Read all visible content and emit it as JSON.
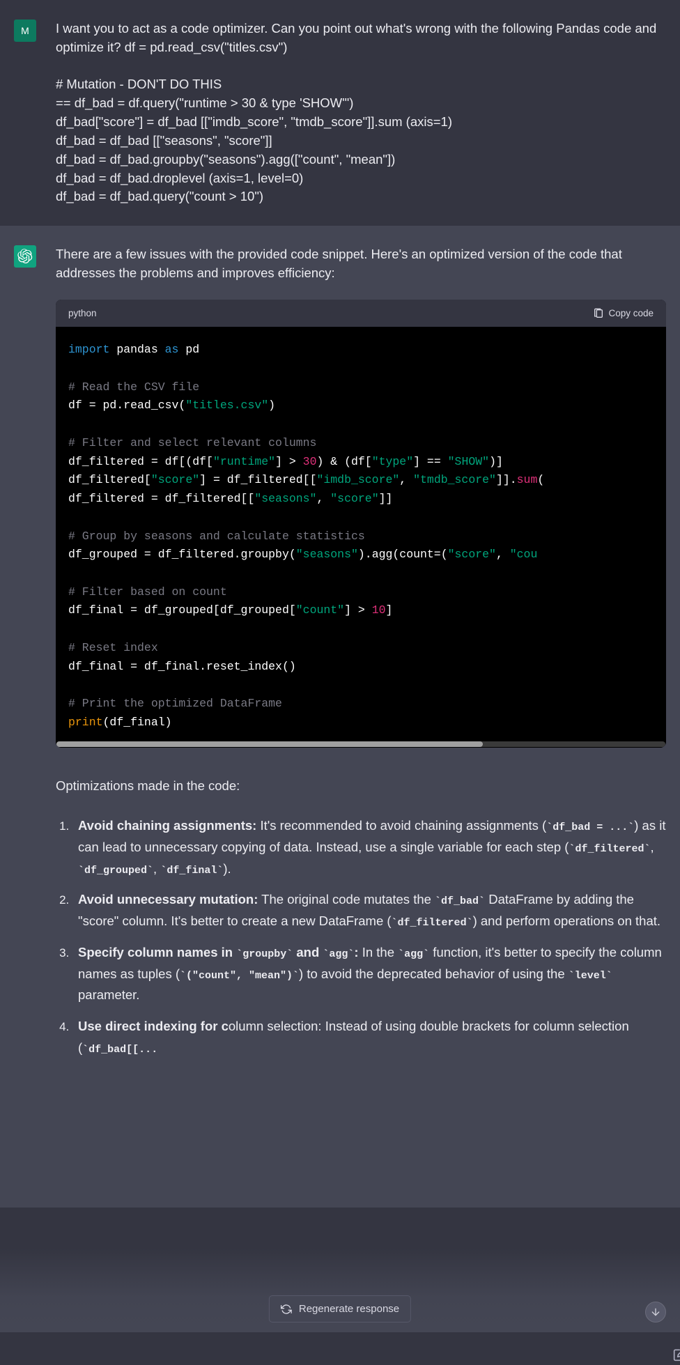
{
  "user": {
    "avatar_letter": "M",
    "message": "I want you to act as a code optimizer. Can you point out what's wrong with the following Pandas code and optimize it? df = pd.read_csv(\"titles.csv\")\n\n# Mutation - DON'T DO THIS\n== df_bad = df.query(\"runtime > 30 & type 'SHOW'\")\ndf_bad[\"score\"] = df_bad [[\"imdb_score\", \"tmdb_score\"]].sum (axis=1)\ndf_bad = df_bad [[\"seasons\", \"score\"]]\ndf_bad = df_bad.groupby(\"seasons\").agg([\"count\", \"mean\"])\ndf_bad = df_bad.droplevel (axis=1, level=0)\ndf_bad = df_bad.query(\"count > 10\")"
  },
  "assistant": {
    "intro": "There are a few issues with the provided code snippet. Here's an optimized version of the code that addresses the problems and improves efficiency:",
    "code_lang": "python",
    "copy_label": "Copy code",
    "code_tokens": [
      [
        [
          "kw",
          "import"
        ],
        [
          "p",
          " pandas "
        ],
        [
          "kw",
          "as"
        ],
        [
          "p",
          " pd"
        ]
      ],
      [],
      [
        [
          "com",
          "# Read the CSV file"
        ]
      ],
      [
        [
          "p",
          "df = pd.read_csv("
        ],
        [
          "str",
          "\"titles.csv\""
        ],
        [
          "p",
          ")"
        ]
      ],
      [],
      [
        [
          "com",
          "# Filter and select relevant columns"
        ]
      ],
      [
        [
          "p",
          "df_filtered = df[(df["
        ],
        [
          "str",
          "\"runtime\""
        ],
        [
          "p",
          "] > "
        ],
        [
          "num",
          "30"
        ],
        [
          "p",
          ") & (df["
        ],
        [
          "str",
          "\"type\""
        ],
        [
          "p",
          "] == "
        ],
        [
          "str",
          "\"SHOW\""
        ],
        [
          "p",
          ")]"
        ]
      ],
      [
        [
          "p",
          "df_filtered["
        ],
        [
          "str",
          "\"score\""
        ],
        [
          "p",
          "] = df_filtered[["
        ],
        [
          "str",
          "\"imdb_score\""
        ],
        [
          "p",
          ", "
        ],
        [
          "str",
          "\"tmdb_score\""
        ],
        [
          "p",
          "]]."
        ],
        [
          "fn",
          "sum"
        ],
        [
          "p",
          "("
        ]
      ],
      [
        [
          "p",
          "df_filtered = df_filtered[["
        ],
        [
          "str",
          "\"seasons\""
        ],
        [
          "p",
          ", "
        ],
        [
          "str",
          "\"score\""
        ],
        [
          "p",
          "]]"
        ]
      ],
      [],
      [
        [
          "com",
          "# Group by seasons and calculate statistics"
        ]
      ],
      [
        [
          "p",
          "df_grouped = df_filtered.groupby("
        ],
        [
          "str",
          "\"seasons\""
        ],
        [
          "p",
          ").agg(count=("
        ],
        [
          "str",
          "\"score\""
        ],
        [
          "p",
          ", "
        ],
        [
          "str",
          "\"cou"
        ]
      ],
      [],
      [
        [
          "com",
          "# Filter based on count"
        ]
      ],
      [
        [
          "p",
          "df_final = df_grouped[df_grouped["
        ],
        [
          "str",
          "\"count\""
        ],
        [
          "p",
          "] > "
        ],
        [
          "num",
          "10"
        ],
        [
          "p",
          "]"
        ]
      ],
      [],
      [
        [
          "com",
          "# Reset index"
        ]
      ],
      [
        [
          "p",
          "df_final = df_final.reset_index()"
        ]
      ],
      [],
      [
        [
          "com",
          "# Print the optimized DataFrame"
        ]
      ],
      [
        [
          "bi",
          "print"
        ],
        [
          "p",
          "(df_final)"
        ]
      ]
    ],
    "opt_heading": "Optimizations made in the code:",
    "items": [
      {
        "bold": "Avoid chaining assignments:",
        "segs": [
          {
            "t": " It's recommended to avoid chaining assignments ("
          },
          {
            "c": "`df_bad = ...`"
          },
          {
            "t": ") as it can lead to unnecessary copying of data. Instead, use a single variable for each step ("
          },
          {
            "c": "`df_filtered`"
          },
          {
            "t": ", "
          },
          {
            "c": "`df_grouped`"
          },
          {
            "t": ", "
          },
          {
            "c": "`df_final`"
          },
          {
            "t": ")."
          }
        ]
      },
      {
        "bold": "Avoid unnecessary mutation:",
        "segs": [
          {
            "t": " The original code mutates the "
          },
          {
            "c": "`df_bad`"
          },
          {
            "t": " DataFrame by adding the \"score\" column. It's better to create a new DataFrame ("
          },
          {
            "c": "`df_filtered`"
          },
          {
            "t": ") and perform operations on that."
          }
        ]
      },
      {
        "bold_segs": [
          {
            "t": "Specify column names in "
          },
          {
            "c": "`groupby`"
          },
          {
            "t": " and "
          },
          {
            "c": "`agg`"
          },
          {
            "t": ":"
          }
        ],
        "segs": [
          {
            "t": " In the "
          },
          {
            "c": "`agg`"
          },
          {
            "t": " function, it's better to specify the column names as tuples ("
          },
          {
            "c": "`(\"count\", \"mean\")`"
          },
          {
            "t": ") to avoid the deprecated behavior of using the "
          },
          {
            "c": "`level`"
          },
          {
            "t": " parameter."
          }
        ]
      },
      {
        "bold": "Use direct indexing for c",
        "segs": [
          {
            "t": "olumn selection: Instead of using double brackets for column selection ("
          },
          {
            "c": "`df_bad[[..."
          }
        ]
      }
    ]
  },
  "regen_label": "Regenerate response"
}
